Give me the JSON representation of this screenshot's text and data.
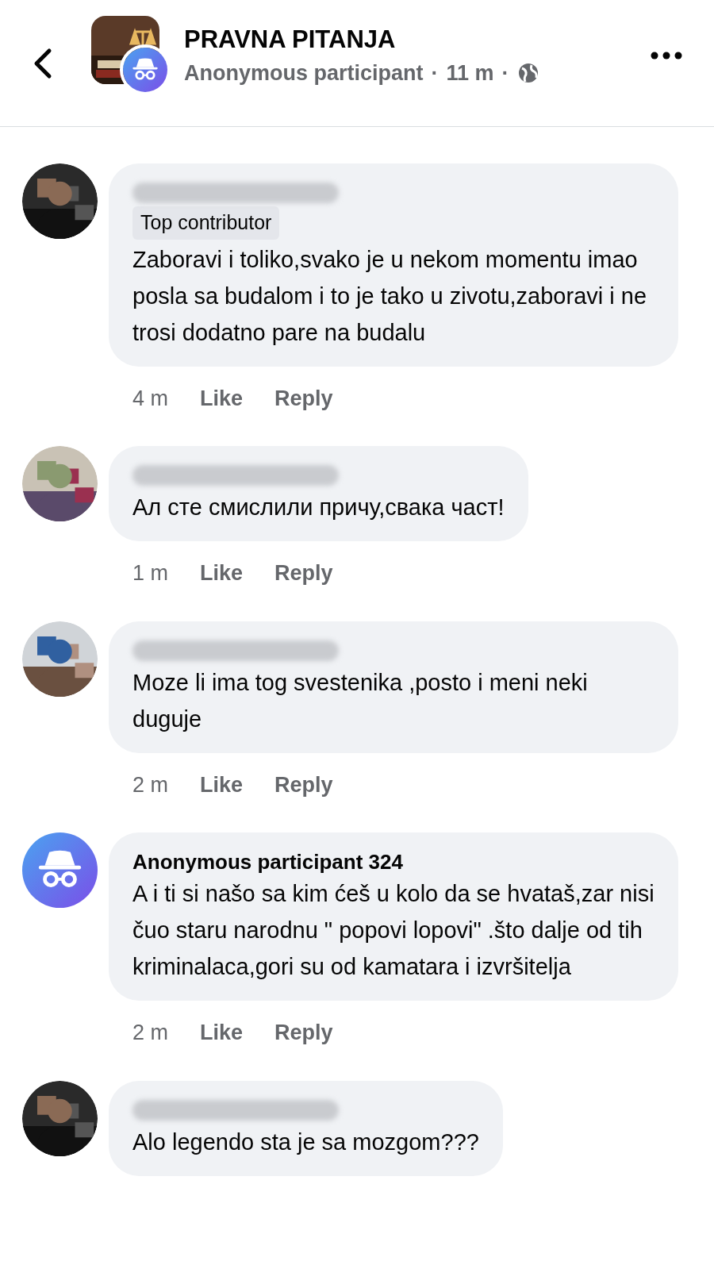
{
  "header": {
    "title": "PRAVNA PITANJA",
    "subtitle": "Anonymous participant",
    "time": "11 m",
    "separator": "·"
  },
  "comments": [
    {
      "kind": "member",
      "badge": "Top contributor",
      "text": "Zaboravi i toliko,svako je u nekom momentu imao posla sa budalom i to je tako u zivotu,zaboravi i ne trosi dodatno pare na budalu",
      "time": "4 m",
      "like": "Like",
      "reply": "Reply"
    },
    {
      "kind": "member",
      "text": "Ал сте смислили причу,свака част!",
      "time": "1 m",
      "like": "Like",
      "reply": "Reply"
    },
    {
      "kind": "member",
      "text": "Moze li ima tog svestenika ,posto i meni neki duguje",
      "time": "2 m",
      "like": "Like",
      "reply": "Reply"
    },
    {
      "kind": "anonymous",
      "name": "Anonymous participant 324",
      "text": "A i ti si našo sa kim ćeš u kolo da se hvataš,zar nisi čuo staru narodnu \" popovi lopovi\" .što dalje od tih kriminalaca,gori su od kamatara i izvršitelja",
      "time": "2 m",
      "like": "Like",
      "reply": "Reply"
    },
    {
      "kind": "member",
      "text": "Alo legendo sta je sa mozgom???"
    }
  ]
}
